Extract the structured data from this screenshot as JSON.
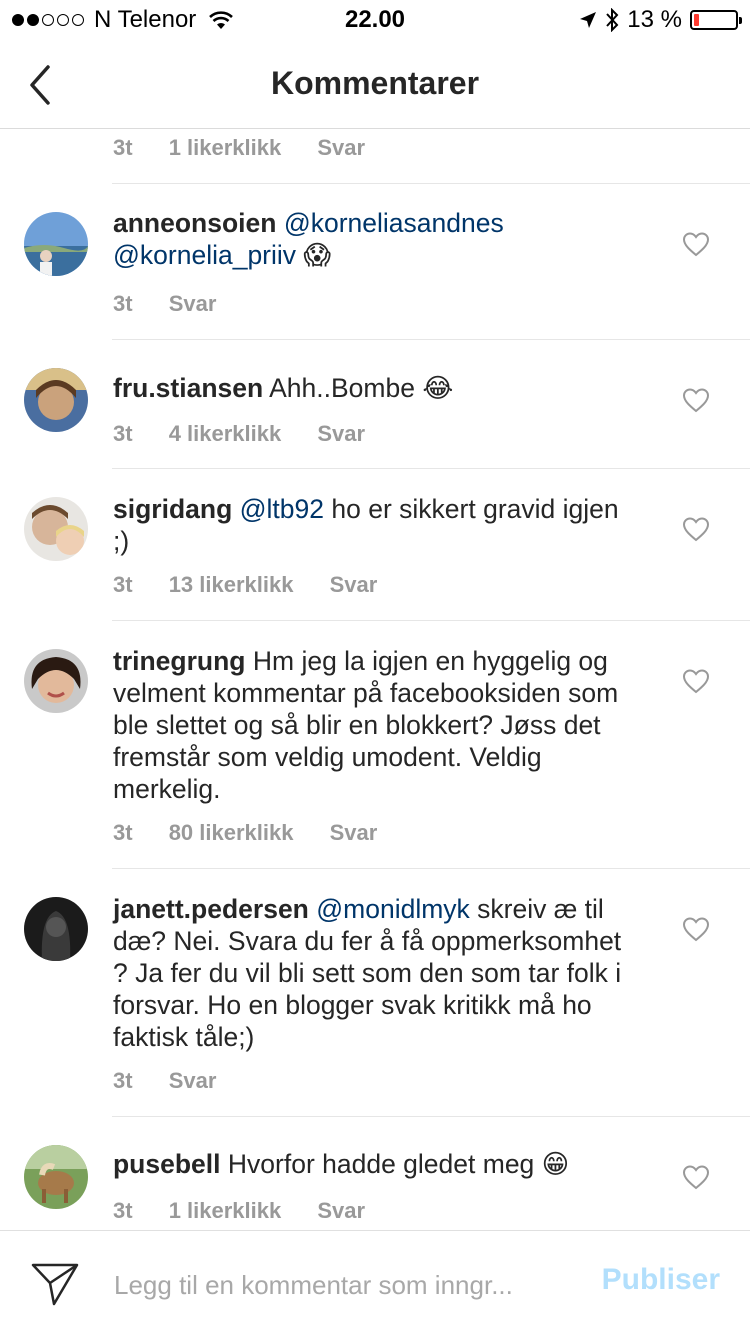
{
  "status_bar": {
    "carrier": "N Telenor",
    "time": "22.00",
    "battery": "13 %",
    "battery_level": 0.13
  },
  "nav": {
    "title": "Kommentarer",
    "back_icon": "chevron-left-icon"
  },
  "previous_comment_meta": {
    "time": "3t",
    "likes": "1 likerklikk",
    "reply": "Svar"
  },
  "comments": [
    {
      "username": "anneonsoien",
      "mention": "@korneliasandnes",
      "mention2": "@kornelia_priiv",
      "emoji": "😱",
      "time": "3t",
      "reply": "Svar"
    },
    {
      "username": "fru.stiansen",
      "text": "Ahh..Bombe",
      "emoji": "😂",
      "time": "3t",
      "likes": "4 likerklikk",
      "reply": "Svar"
    },
    {
      "username": "sigridang",
      "mention": "@ltb92",
      "text": "ho er sikkert gravid igjen ;)",
      "time": "3t",
      "likes": "13 likerklikk",
      "reply": "Svar"
    },
    {
      "username": "trinegrung",
      "text": "Hm jeg la igjen en hyggelig og velment kommentar på facebooksiden som ble slettet og så blir en blokkert? Jøss det fremstår som veldig umodent. Veldig merkelig.",
      "time": "3t",
      "likes": "80 likerklikk",
      "reply": "Svar"
    },
    {
      "username": "janett.pedersen",
      "mention": "@monidlmyk",
      "text": "skreiv æ til dæ? Nei.  Svara du fer å få oppmerksomhet ? Ja fer du vil bli sett som den som tar folk i forsvar.  Ho en blogger svak kritikk må ho faktisk tåle;)",
      "time": "3t",
      "reply": "Svar"
    },
    {
      "username": "pusebell",
      "text": "Hvorfor hadde gledet meg",
      "emoji": "😁",
      "time": "3t",
      "likes": "1 likerklikk",
      "reply": "Svar"
    }
  ],
  "composer": {
    "placeholder": "Legg til en kommentar som inngr...",
    "publish_label": "Publiser",
    "send_icon": "paper-plane-icon"
  },
  "colors": {
    "mention": "#003569",
    "meta": "#999999",
    "publish": "#b2dffc",
    "battery_low": "#ff3b30"
  }
}
